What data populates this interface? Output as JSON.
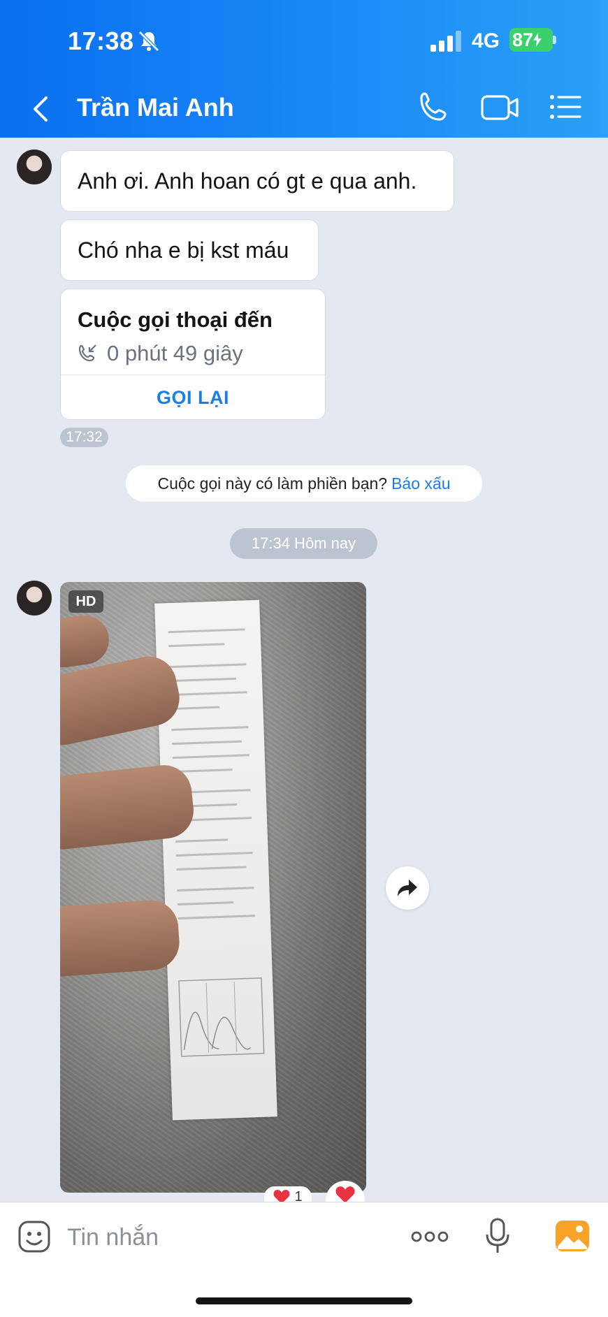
{
  "status_bar": {
    "time": "17:38",
    "network": "4G",
    "battery": "87"
  },
  "header": {
    "contact_name": "Trần Mai Anh"
  },
  "messages": [
    {
      "text": "Anh ơi. Anh hoan có gt e qua anh."
    },
    {
      "text": "Chó nha e bị kst máu"
    }
  ],
  "call_card": {
    "title": "Cuộc gọi thoại đến",
    "duration": "0 phút 49 giây",
    "callback_label": "GỌI LẠI",
    "time": "17:32"
  },
  "report_prompt": {
    "text": "Cuộc gọi này có làm phiền bạn?",
    "link": "Báo xấu"
  },
  "date_divider": "17:34 Hôm nay",
  "photo": {
    "badge": "HD"
  },
  "reactions": {
    "count": "1"
  },
  "composer": {
    "placeholder": "Tin nhắn"
  },
  "colors": {
    "header_start": "#0a6ff0",
    "header_end": "#2aa0f7",
    "accent": "#1a7ee6",
    "battery": "#39d16b",
    "chat_bg": "#e3e8f1",
    "heart": "#e8323f"
  },
  "icons": [
    "bell-muted-icon",
    "signal-icon",
    "back-arrow-icon",
    "phone-icon",
    "video-camera-icon",
    "list-menu-icon",
    "incoming-call-icon",
    "forward-icon",
    "heart-icon",
    "sticker-icon",
    "more-options-icon",
    "microphone-icon",
    "gallery-icon"
  ]
}
